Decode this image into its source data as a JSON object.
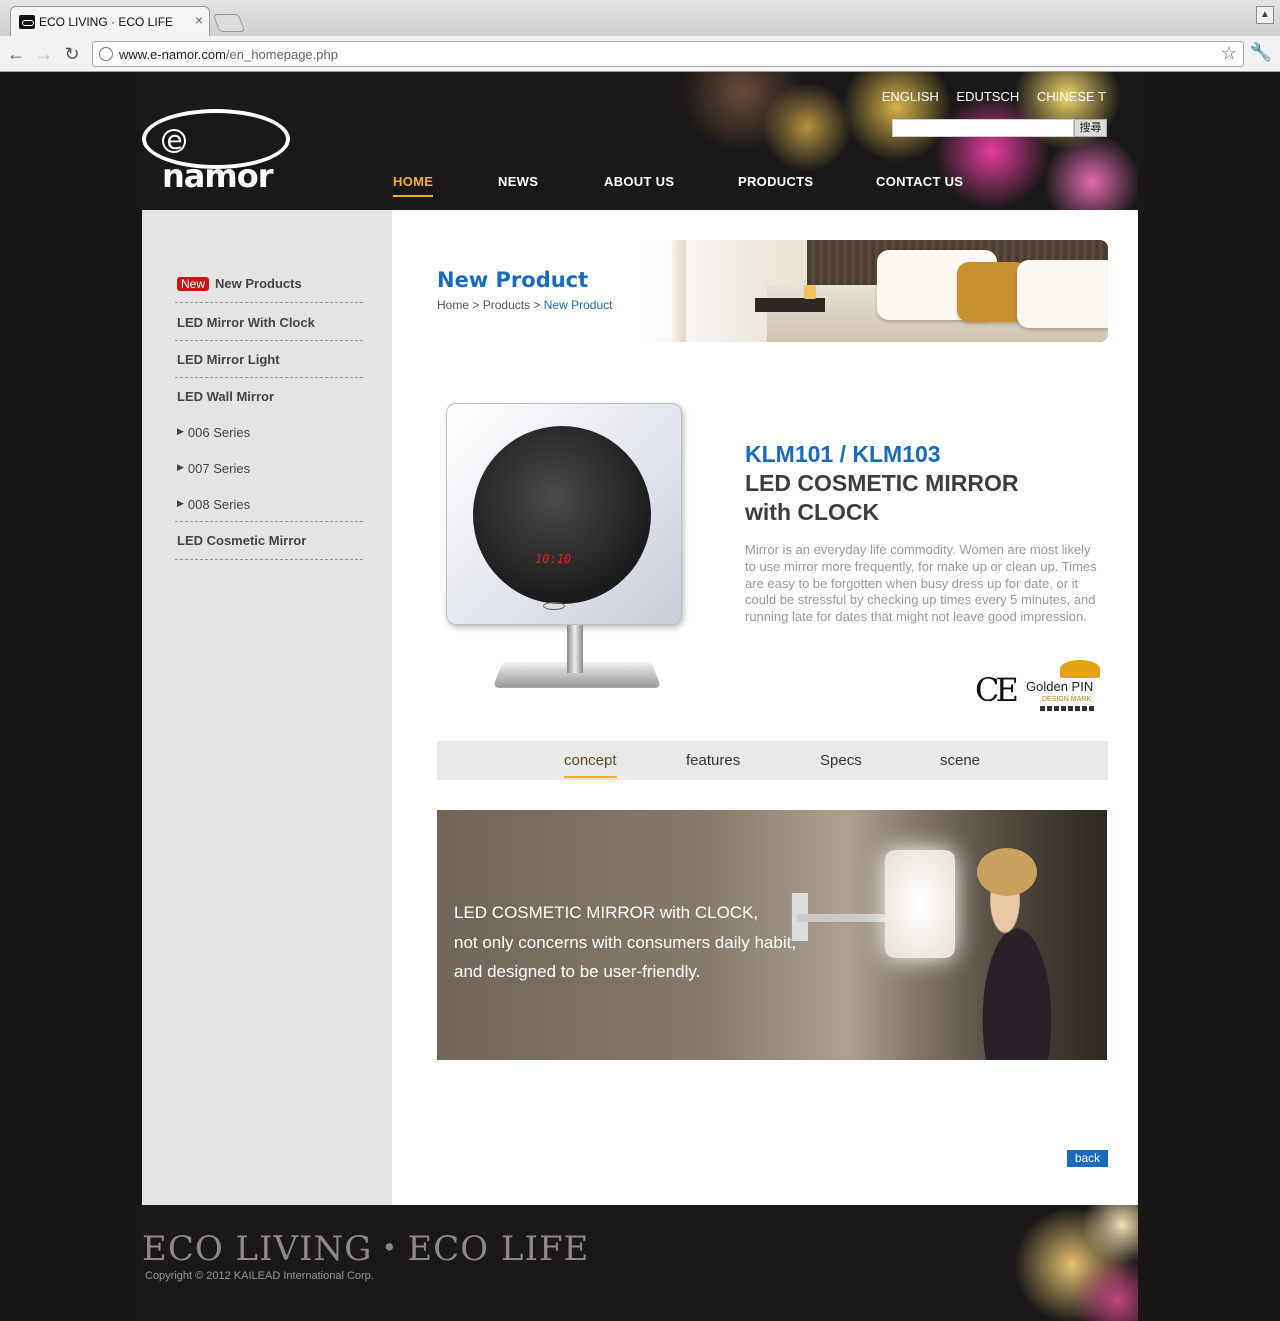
{
  "browser": {
    "tab_title": "ECO LIVING · ECO LIFE",
    "url_host": "www.e-namor.com",
    "url_path": "/en_homepage.php"
  },
  "header": {
    "logo_text": "namor",
    "logo_letter": "e",
    "languages": [
      "ENGLISH",
      "EDUTSCH",
      "CHINESE T"
    ],
    "search_button": "搜尋",
    "search_value": "",
    "nav": [
      "HOME",
      "NEWS",
      "ABOUT US",
      "PRODUCTS",
      "CONTACT US"
    ],
    "active_nav": "HOME",
    "accent_color": "#f2b21d"
  },
  "sidebar": {
    "new_badge": "New",
    "items": [
      {
        "label": "New Products"
      },
      {
        "label": "LED Mirror With Clock"
      },
      {
        "label": "LED Mirror Light"
      },
      {
        "label": "LED Wall Mirror"
      },
      {
        "label": "006 Series"
      },
      {
        "label": "007 Series"
      },
      {
        "label": "008 Series"
      },
      {
        "label": "LED Cosmetic Mirror"
      }
    ]
  },
  "banner": {
    "title": "New Product",
    "breadcrumb": [
      "Home",
      "Products",
      "New Product"
    ],
    "separator": ">"
  },
  "product": {
    "model": "KLM101 / KLM103",
    "name_line1": "LED COSMETIC MIRROR",
    "name_line2": "with CLOCK",
    "clock_display": "10:10",
    "description": "Mirror is an everyday life commodity. Women are most likely to use mirror more frequently, for make up or clean up. Times are easy to be forgotten when busy dress up for date, or it could be stressful by checking up times every 5 minutes, and running late for dates that might not leave good impression.",
    "ce_mark": "CE",
    "award_name_1": "Golden",
    "award_name_2": "PIN",
    "award_sub": "DESIGN MARK"
  },
  "tabs": [
    "concept",
    "features",
    "Specs",
    "scene"
  ],
  "active_tab": "concept",
  "scene": {
    "lines": [
      "LED COSMETIC MIRROR with CLOCK,",
      "not only concerns with consumers daily habit,",
      "and designed to be user-friendly."
    ]
  },
  "back_button": "back",
  "link_color": "#1a6bbf",
  "footer": {
    "slogan": "ECO LIVING・ECO LIFE",
    "copyright": "Copyright ©  2012 KAILEAD International Corp."
  }
}
